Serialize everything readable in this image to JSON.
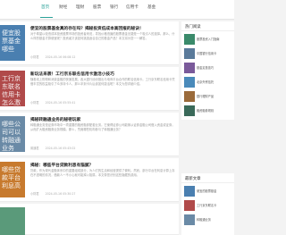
{
  "nav": {
    "items": [
      "首页",
      "财经",
      "理财",
      "股票",
      "银行",
      "信用卡",
      "基金"
    ]
  },
  "articles": [
    {
      "title": "便宜的股票基金真的存在吗？揭秘投资低成本高回报的秘诀！",
      "excerpt": "对于希望以较低成本投资股票市场的投资者来说，寻找价格低廉的股票基金无疑是一个吸引人的选择。那么，什么样的基金才算便宜呢？投资者又该如何挑选适合自己的基金产品？本文将为您一一解答。",
      "author": "小财君",
      "date": "2024-05-16 06:08:12",
      "thumb_text": "便宜股票基金哪些",
      "thumb_color": "#4a7fb0"
    },
    {
      "title": "新玩法来袭！工行京东联名信用卡激活小技巧",
      "excerpt": "随着线上购物和消费金融的快速发展，各大银行纷纷推出与电商平台合作的联名信用卡。工行京东联名信用卡凭借丰富的权益吸引了众多持卡人，那么拿到卡片后该如何激活呢？本文为您详细介绍。",
      "author": "小财君",
      "date": "2024-05-16 05:55:41",
      "thumb_text": "工行京东联名信用卡怎么激活",
      "thumb_color": "#b04a4a"
    },
    {
      "title": "揭秘转融通业务的秘密玩家",
      "excerpt": "转融通业务是证券市场中一项重要的融资融券配套业务。它使得证券公司能够从证券金融公司借入资金或证券，从而扩大融资融券业务规模。那么，究竟哪些机构参与了转融通业务？",
      "author": "普通君",
      "date": "2024-05-16 05:43:02",
      "thumb_text": "哪些公司可以转融通业务",
      "thumb_color": "#6a8aa6"
    },
    {
      "title": "揭秘：哪些平台贷款利息有猫腻？",
      "excerpt": "贷款，作为现代金融体系中的重要组成部分，为人们的生活和经营提供了便利。然而，部分平台在利息计算上存在不透明的情况，借款人一不小心就可能掉入陷阱。本文带您识别这些隐藏的费用。",
      "author": "小财君",
      "date": "2024-05-16 05:30:27",
      "thumb_text": "哪些贷款平台利息高",
      "thumb_color": "#c77a2e"
    },
    {
      "title": "",
      "excerpt": "",
      "author": "",
      "date": "",
      "thumb_text": "",
      "thumb_color": "#5a9a7a"
    }
  ],
  "sidebar": {
    "hot_title": "热门阅读",
    "hot_items": [
      {
        "text": "股票投资入门指南",
        "color": "#3a8a6a"
      },
      {
        "text": "中国银行信用卡",
        "color": "#5a7a9a"
      },
      {
        "text": "基金定投技巧",
        "color": "#7a5a9a"
      },
      {
        "text": "北京外贸信托",
        "color": "#4a8aba"
      },
      {
        "text": "银行理财产品",
        "color": "#9a6a3a"
      },
      {
        "text": "融资融券规则",
        "color": "#3a6a5a"
      }
    ],
    "latest_title": "最新文章",
    "latest_items": [
      {
        "text": "便宜的股票基金",
        "color": "#4a7fb0"
      },
      {
        "text": "工行京东联名卡",
        "color": "#b04a4a"
      },
      {
        "text": "转融通业务",
        "color": "#6a8aa6"
      }
    ]
  }
}
